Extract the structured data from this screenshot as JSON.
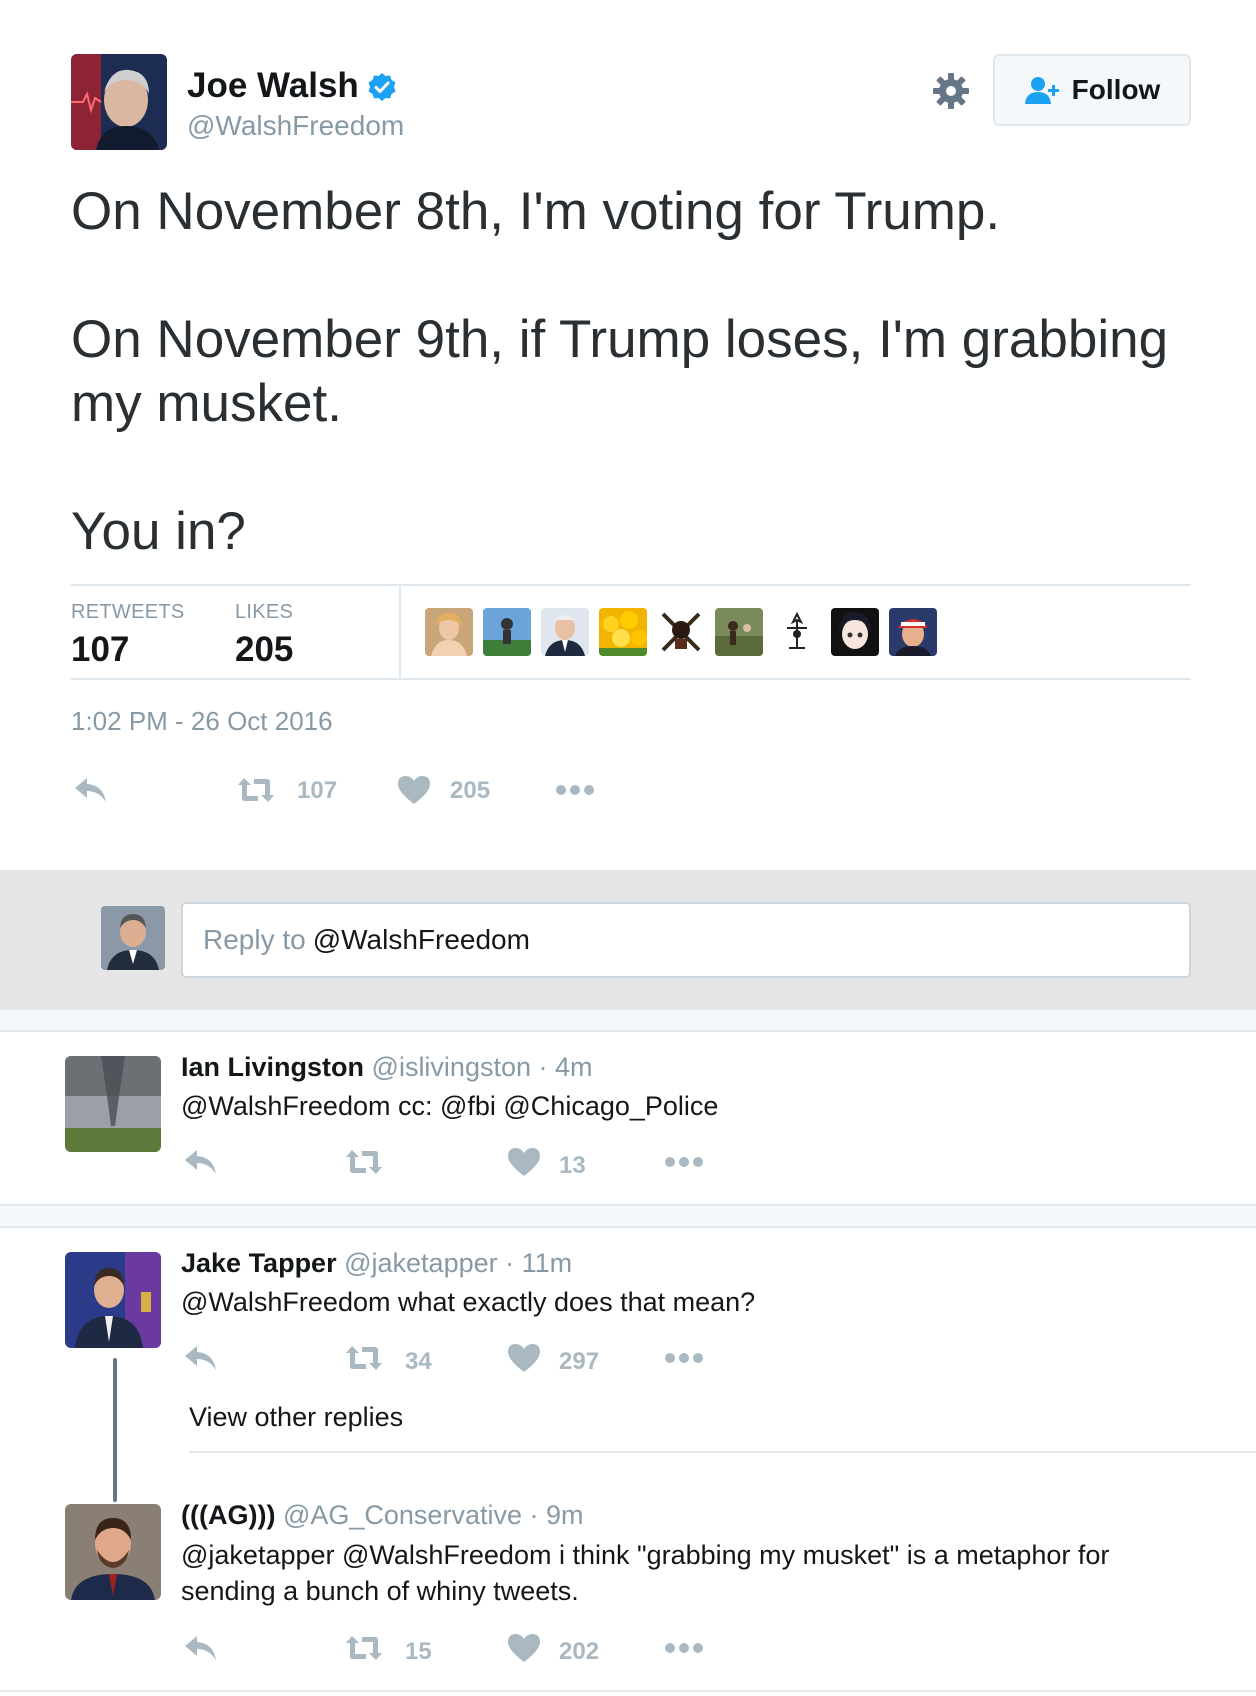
{
  "main_tweet": {
    "author_name": "Joe Walsh",
    "handle": "@WalshFreedom",
    "verified": true,
    "follow_label": "Follow",
    "text_lines": [
      "On November 8th, I'm voting for Trump.",
      "On November 9th, if Trump loses, I'm grabbing",
      "my musket.",
      "You in?"
    ],
    "retweets_label": "RETWEETS",
    "retweets": "107",
    "likes_label": "LIKES",
    "likes": "205",
    "timestamp": "1:02 PM - 26 Oct 2016",
    "actions": {
      "retweet_count": "107",
      "like_count": "205"
    }
  },
  "reply_box": {
    "placeholder_prefix": "Reply to",
    "placeholder_handle": "@WalshFreedom"
  },
  "replies": [
    {
      "name": "Ian Livingston",
      "handle": "@islivingston",
      "time": "4m",
      "text": "@WalshFreedom cc: @fbi @Chicago_Police",
      "retweets": "",
      "likes": "13"
    },
    {
      "name": "Jake Tapper",
      "handle": "@jaketapper",
      "time": "11m",
      "text": "@WalshFreedom what exactly does that mean?",
      "retweets": "34",
      "likes": "297"
    },
    {
      "name": "(((AG)))",
      "handle": "@AG_Conservative",
      "time": "9m",
      "text_line1": "@jaketapper @WalshFreedom i think \"grabbing my musket\" is a metaphor for",
      "text_line2": "sending a bunch of whiny tweets.",
      "retweets": "15",
      "likes": "202"
    }
  ],
  "view_other_replies": "View other replies",
  "colors": {
    "accent_blue": "#1da1f2",
    "muted_gray": "#8899a6",
    "icon_gray": "#aab8c2"
  }
}
